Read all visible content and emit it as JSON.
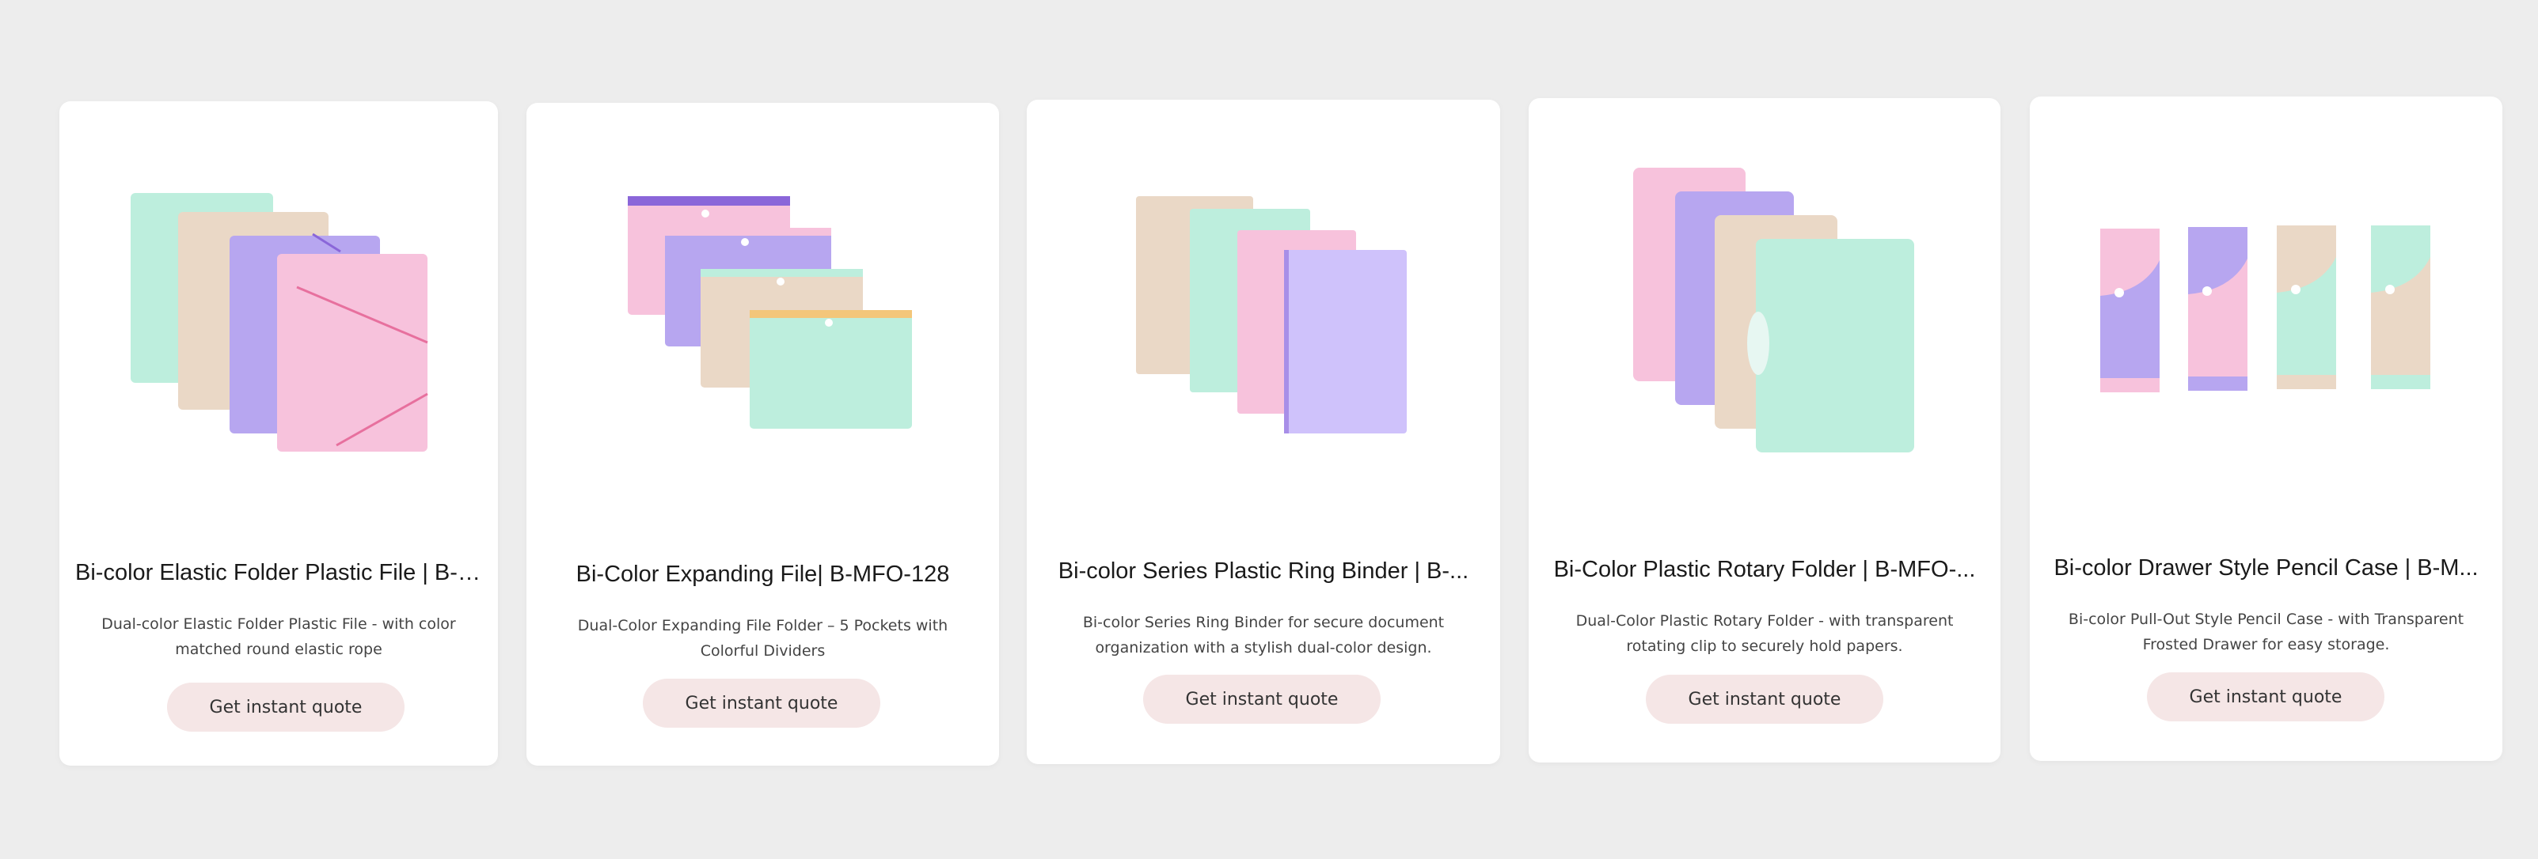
{
  "products": [
    {
      "title": "Bi-color Elastic Folder Plastic File | B-MFO-...",
      "description": "Dual-color Elastic Folder Plastic File - with color matched round elastic rope",
      "button": "Get instant quote"
    },
    {
      "title": "Bi-Color Expanding File| B-MFO-128",
      "description": "Dual-Color Expanding File Folder – 5 Pockets with Colorful Dividers",
      "button": "Get instant quote"
    },
    {
      "title": "Bi-color Series Plastic Ring Binder | B-...",
      "description": "Bi-color Series Ring Binder for secure document organization with a stylish dual-color design.",
      "button": "Get instant quote"
    },
    {
      "title": "Bi-Color Plastic Rotary Folder | B-MFO-...",
      "description": "Dual-Color Plastic Rotary Folder - with transparent rotating clip to securely hold papers.",
      "button": "Get instant quote"
    },
    {
      "title": "Bi-color Drawer Style Pencil Case | B-M...",
      "description": "Bi-color Pull-Out Style Pencil Case - with Transparent Frosted Drawer for easy storage.",
      "button": "Get instant quote"
    }
  ],
  "colors": {
    "page_bg": "#ededed",
    "card_bg": "#ffffff",
    "button_bg": "#f5e6e6",
    "mint": "#bdeedd",
    "beige": "#ead8c6",
    "lavender": "#b7a6f0",
    "pink": "#f7c2dc"
  }
}
